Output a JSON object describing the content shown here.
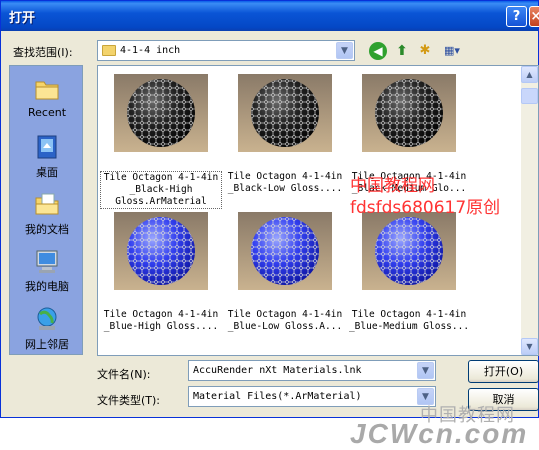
{
  "window": {
    "title": "打开",
    "help_label": "?",
    "close_label": "×"
  },
  "lookin": {
    "label": "查找范围(I):",
    "value": "4-1-4 inch"
  },
  "toolbar": {
    "back_icon": "back-arrow-icon",
    "up_icon": "up-folder-icon",
    "newfolder_icon": "new-folder-icon",
    "views_icon": "views-menu-icon"
  },
  "places": [
    {
      "label": "Recent",
      "icon": "recent-folder-icon"
    },
    {
      "label": "桌面",
      "icon": "desktop-icon"
    },
    {
      "label": "我的文档",
      "icon": "my-documents-icon"
    },
    {
      "label": "我的电脑",
      "icon": "my-computer-icon"
    },
    {
      "label": "网上邻居",
      "icon": "network-places-icon"
    }
  ],
  "files": [
    {
      "line1": "Tile Octagon 4-1-4in",
      "line2": "_Black-High",
      "line3": "Gloss.ArMaterial",
      "color": "black",
      "selected": true
    },
    {
      "line1": "Tile Octagon 4-1-4in",
      "line2": "_Black-Low Gloss....",
      "line3": "",
      "color": "black",
      "selected": false
    },
    {
      "line1": "Tile Octagon 4-1-4in",
      "line2": "_Black-Medium Glo...",
      "line3": "",
      "color": "black",
      "selected": false
    },
    {
      "line1": "Tile Octagon 4-1-4in",
      "line2": "_Blue-High Gloss....",
      "line3": "",
      "color": "blue",
      "selected": false
    },
    {
      "line1": "Tile Octagon 4-1-4in",
      "line2": "_Blue-Low Gloss.A...",
      "line3": "",
      "color": "blue",
      "selected": false
    },
    {
      "line1": "Tile Octagon 4-1-4in",
      "line2": "_Blue-Medium Gloss...",
      "line3": "",
      "color": "blue",
      "selected": false
    }
  ],
  "overlay": {
    "line1": "中国教程网",
    "line2": "fdsfds680617原创"
  },
  "filename": {
    "label": "文件名(N):",
    "value": "AccuRender nXt Materials.lnk"
  },
  "filetype": {
    "label": "文件类型(T):",
    "value": "Material Files(*.ArMaterial)"
  },
  "buttons": {
    "open": "打开(O)",
    "cancel": "取消"
  },
  "site_watermark": {
    "cn": "中国教程网",
    "en": "JCWcn.com"
  },
  "colors": {
    "title_bar": "#0a55d6",
    "dialog_bg": "#ece9d8",
    "places_bg": "#8aa3e0",
    "overlay_text": "#ff3333"
  }
}
